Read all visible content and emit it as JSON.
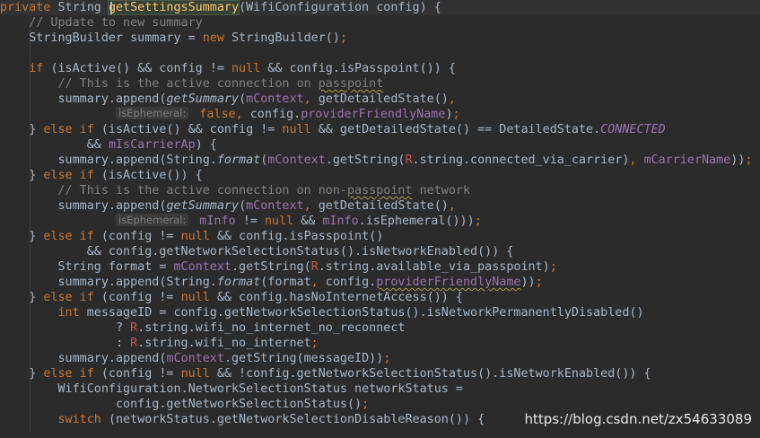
{
  "editor": {
    "lines": [
      [
        [
          "kw",
          "private "
        ],
        [
          "dflt",
          "String "
        ],
        [
          "fn hl-word",
          "getSettingsSummary"
        ],
        [
          "dflt",
          "(WifiConfiguration config) {"
        ]
      ],
      [
        [
          "dflt",
          "    "
        ],
        [
          "cm",
          "// Update to new summary"
        ]
      ],
      [
        [
          "dflt",
          "    StringBuilder summary = "
        ],
        [
          "kw",
          "new "
        ],
        [
          "dflt",
          "StringBuilder()"
        ],
        [
          "kw",
          ";"
        ]
      ],
      [
        [
          "dflt",
          ""
        ]
      ],
      [
        [
          "dflt",
          "    "
        ],
        [
          "kw",
          "if "
        ],
        [
          "dflt",
          "(isActive() && config != "
        ],
        [
          "kw",
          "null "
        ],
        [
          "dflt",
          "&& config.isPasspoint()) {"
        ]
      ],
      [
        [
          "dflt",
          "        "
        ],
        [
          "cm",
          "// This is the active connection on "
        ],
        [
          "cm squiggle",
          "passpoint"
        ]
      ],
      [
        [
          "dflt",
          "        summary.append("
        ],
        [
          "it",
          "getSummary"
        ],
        [
          "dflt",
          "("
        ],
        [
          "fld",
          "mContext"
        ],
        [
          "kw",
          ", "
        ],
        [
          "dflt",
          "getDetailedState()"
        ],
        [
          "kw",
          ","
        ]
      ],
      [
        [
          "dflt",
          "                "
        ],
        [
          "hint",
          "isEphemeral:"
        ],
        [
          "kw",
          " false"
        ],
        [
          "kw",
          ", "
        ],
        [
          "dflt",
          "config."
        ],
        [
          "fld",
          "providerFriendlyName"
        ],
        [
          "dflt",
          ")"
        ],
        [
          "kw",
          ";"
        ]
      ],
      [
        [
          "dflt",
          "    } "
        ],
        [
          "kw",
          "else if "
        ],
        [
          "dflt",
          "(isActive() && config != "
        ],
        [
          "kw",
          "null "
        ],
        [
          "dflt",
          "&& getDetailedState() == DetailedState."
        ],
        [
          "fld it",
          "CONNECTED"
        ]
      ],
      [
        [
          "dflt",
          "            && "
        ],
        [
          "fld",
          "mIsCarrierAp"
        ],
        [
          "dflt",
          ") {"
        ]
      ],
      [
        [
          "dflt",
          "        summary.append(String."
        ],
        [
          "it",
          "format"
        ],
        [
          "dflt",
          "("
        ],
        [
          "fld",
          "mContext"
        ],
        [
          "dflt",
          ".getString("
        ],
        [
          "r",
          "R"
        ],
        [
          "dflt",
          ".string.connected_via_carrier)"
        ],
        [
          "kw",
          ", "
        ],
        [
          "fld",
          "mCarrierName"
        ],
        [
          "dflt",
          "))"
        ],
        [
          "kw",
          ";"
        ]
      ],
      [
        [
          "dflt",
          "    } "
        ],
        [
          "kw",
          "else if "
        ],
        [
          "dflt",
          "(isActive()) {"
        ]
      ],
      [
        [
          "dflt",
          "        "
        ],
        [
          "cm",
          "// This is the active connection on non-"
        ],
        [
          "cm squiggle",
          "passpoint"
        ],
        [
          "cm",
          " network"
        ]
      ],
      [
        [
          "dflt",
          "        summary.append("
        ],
        [
          "it",
          "getSummary"
        ],
        [
          "dflt",
          "("
        ],
        [
          "fld",
          "mContext"
        ],
        [
          "kw",
          ", "
        ],
        [
          "dflt",
          "getDetailedState()"
        ],
        [
          "kw",
          ","
        ]
      ],
      [
        [
          "dflt",
          "                "
        ],
        [
          "hint",
          "isEphemeral:"
        ],
        [
          "fld",
          " mInfo "
        ],
        [
          "dflt",
          "!= "
        ],
        [
          "kw",
          "null "
        ],
        [
          "dflt",
          "&& "
        ],
        [
          "fld",
          "mInfo"
        ],
        [
          "dflt",
          ".isEphemeral()))"
        ],
        [
          "kw",
          ";"
        ]
      ],
      [
        [
          "dflt",
          "    } "
        ],
        [
          "kw",
          "else if "
        ],
        [
          "dflt",
          "(config != "
        ],
        [
          "kw",
          "null "
        ],
        [
          "dflt",
          "&& config.isPasspoint()"
        ]
      ],
      [
        [
          "dflt",
          "            && config.getNetworkSelectionStatus().isNetworkEnabled()) {"
        ]
      ],
      [
        [
          "dflt",
          "        String format = "
        ],
        [
          "fld",
          "mContext"
        ],
        [
          "dflt",
          ".getString("
        ],
        [
          "r",
          "R"
        ],
        [
          "dflt",
          ".string.available_via_passpoint)"
        ],
        [
          "kw",
          ";"
        ]
      ],
      [
        [
          "dflt",
          "        summary.append(String."
        ],
        [
          "it",
          "format"
        ],
        [
          "dflt",
          "(format"
        ],
        [
          "kw",
          ", "
        ],
        [
          "dflt",
          "config."
        ],
        [
          "fld squiggle",
          "providerFriendlyName"
        ],
        [
          "dflt",
          "))"
        ],
        [
          "kw",
          ";"
        ]
      ],
      [
        [
          "dflt",
          "    } "
        ],
        [
          "kw",
          "else if "
        ],
        [
          "dflt",
          "(config != "
        ],
        [
          "kw",
          "null "
        ],
        [
          "dflt",
          "&& config.hasNoInternetAccess()) {"
        ]
      ],
      [
        [
          "dflt",
          "        "
        ],
        [
          "kw",
          "int "
        ],
        [
          "dflt",
          "messageID = config.getNetworkSelectionStatus().isNetworkPermanentlyDisabled()"
        ]
      ],
      [
        [
          "dflt",
          "                ? "
        ],
        [
          "r",
          "R"
        ],
        [
          "dflt",
          ".string.wifi_no_internet_no_reconnect"
        ]
      ],
      [
        [
          "dflt",
          "                : "
        ],
        [
          "r",
          "R"
        ],
        [
          "dflt",
          ".string.wifi_no_internet"
        ],
        [
          "kw",
          ";"
        ]
      ],
      [
        [
          "dflt",
          "        summary.append("
        ],
        [
          "fld",
          "mContext"
        ],
        [
          "dflt",
          ".getString(messageID))"
        ],
        [
          "kw",
          ";"
        ]
      ],
      [
        [
          "dflt",
          "    } "
        ],
        [
          "kw",
          "else if "
        ],
        [
          "dflt",
          "(config != "
        ],
        [
          "kw",
          "null "
        ],
        [
          "dflt",
          "&& !config.getNetworkSelectionStatus().isNetworkEnabled()) {"
        ]
      ],
      [
        [
          "dflt",
          "        WifiConfiguration.NetworkSelectionStatus networkStatus ="
        ]
      ],
      [
        [
          "dflt",
          "                config.getNetworkSelectionStatus()"
        ],
        [
          "kw",
          ";"
        ]
      ],
      [
        [
          "dflt",
          "        "
        ],
        [
          "kw",
          "switch "
        ],
        [
          "dflt",
          "(networkStatus.getNetworkSelectionDisableReason()) {"
        ]
      ]
    ]
  },
  "watermark": "https://blog.csdn.net/zx54633089"
}
